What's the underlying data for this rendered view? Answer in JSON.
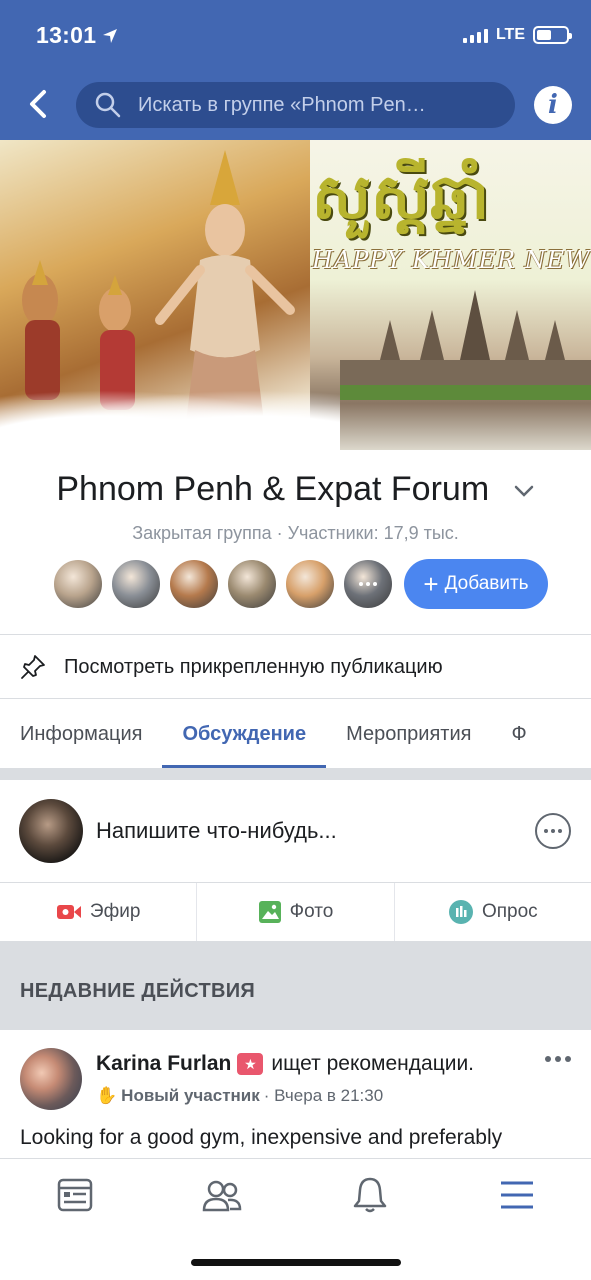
{
  "status": {
    "time": "13:01",
    "network": "LTE",
    "battery_level": 0.5
  },
  "nav": {
    "search_placeholder": "Искать в группе «Phnom Pen…",
    "back_icon": "chevron-left-icon",
    "info_icon": "info-icon",
    "info_glyph": "i"
  },
  "cover": {
    "title_khmer": "សួស្តីឆ្នាំ",
    "subtitle": "HAPPY KHMER NEW Y"
  },
  "group": {
    "name": "Phnom Penh & Expat Forum",
    "meta": "Закрытая группа · Участники: 17,9 тыс.",
    "add_label": "Добавить",
    "member_colors": [
      "#b9a48d",
      "#8a8f96",
      "#b57a4d",
      "#9b8a70",
      "#d7a06a",
      "#6d7178"
    ]
  },
  "pinned": {
    "label": "Посмотреть прикрепленную публикацию"
  },
  "tabs": [
    {
      "label": "Информация"
    },
    {
      "label": "Обсуждение"
    },
    {
      "label": "Мероприятия"
    },
    {
      "label": "Ф"
    }
  ],
  "composer": {
    "placeholder": "Напишите что-нибудь..."
  },
  "actions": [
    {
      "label": "Эфир",
      "color": "#e9474a"
    },
    {
      "label": "Фото",
      "color": "#58b25a"
    },
    {
      "label": "Опрос",
      "color": "#59b3b0"
    }
  ],
  "recent": {
    "heading": "НЕДАВНИЕ ДЕЙСТВИЯ"
  },
  "post": {
    "author": "Karina Furlan",
    "action": "ищет рекомендации.",
    "role": "Новый участник",
    "time": "· Вчера в 21:30",
    "text": "Looking for a good gym, inexpensive and preferably"
  },
  "colors": {
    "brand": "#4267b2",
    "add_button": "#4b86f0",
    "active_tab": "#4267b2"
  }
}
